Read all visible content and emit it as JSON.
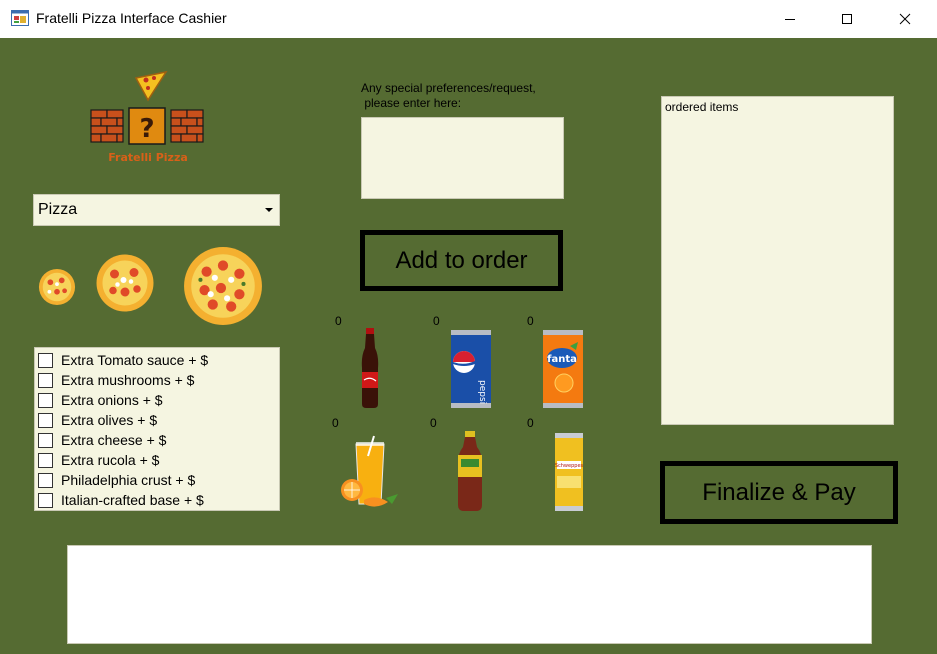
{
  "window": {
    "title": "Fratelli Pizza Interface Cashier",
    "icon": "windows-form-icon",
    "controls": [
      "minimize-icon",
      "maximize-icon",
      "close-icon"
    ]
  },
  "colors": {
    "background": "#556b32",
    "input_background": "#f5f5e1",
    "button_border": "#000000"
  },
  "logo": {
    "text": "Fratelli Pizza",
    "icon": "question-block-logo"
  },
  "product_select": {
    "value": "Pizza"
  },
  "sizes": [
    "small-pizza",
    "medium-pizza",
    "large-pizza"
  ],
  "extras": [
    {
      "label": "Extra Tomato sauce + $",
      "checked": false
    },
    {
      "label": "Extra mushrooms + $",
      "checked": false
    },
    {
      "label": "Extra onions + $",
      "checked": false
    },
    {
      "label": "Extra olives + $",
      "checked": false
    },
    {
      "label": "Extra cheese + $",
      "checked": false
    },
    {
      "label": "Extra rucola + $",
      "checked": false
    },
    {
      "label": "Philadelphia crust + $",
      "checked": false
    },
    {
      "label": "Italian-crafted base + $",
      "checked": false
    }
  ],
  "preferences": {
    "label": "Any special preferences/request,\n please enter here:",
    "value": ""
  },
  "add_button": {
    "label": "Add to order"
  },
  "drinks": [
    {
      "icon": "coca-cola-bottle",
      "count": "0"
    },
    {
      "icon": "pepsi-can",
      "count": "0"
    },
    {
      "icon": "fanta-can",
      "count": "0"
    },
    {
      "icon": "orange-juice-glass",
      "count": "0"
    },
    {
      "icon": "iced-tea-bottle",
      "count": "0"
    },
    {
      "icon": "schweppes-can",
      "count": "0"
    }
  ],
  "ordered_items": {
    "label": "ordered items"
  },
  "pay_button": {
    "label": "Finalize & Pay"
  },
  "status": {
    "value": ""
  }
}
